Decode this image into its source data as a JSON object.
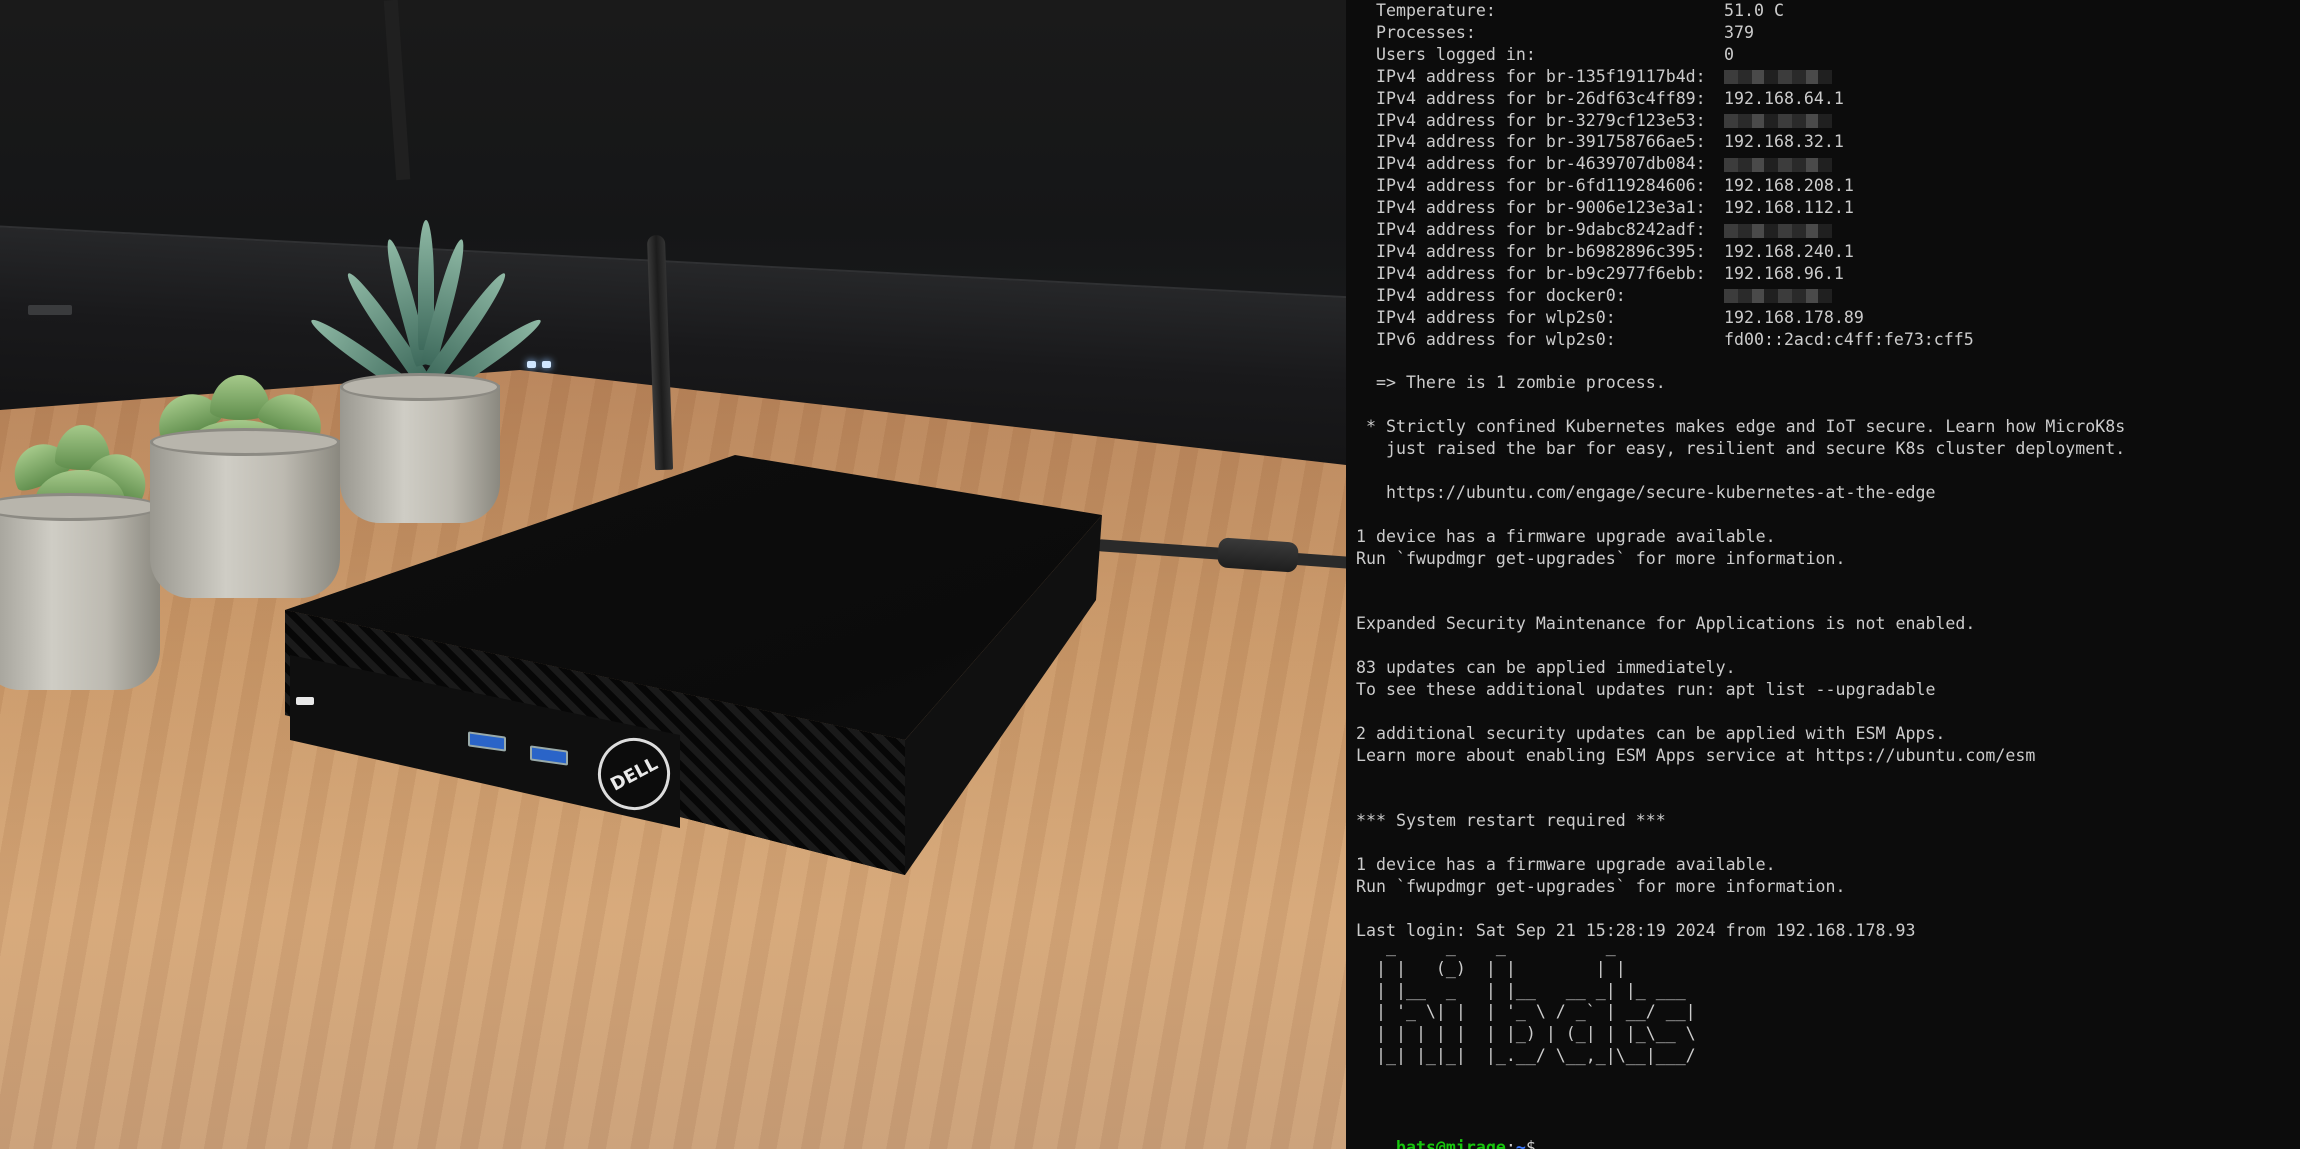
{
  "photo": {
    "brand_logo": "DELL",
    "subject": "mini-pc"
  },
  "terminal": {
    "sysinfo": [
      {
        "label": "  Temperature:",
        "value": "51.0 C",
        "redacted": false
      },
      {
        "label": "  Processes:",
        "value": "379",
        "redacted": false
      },
      {
        "label": "  Users logged in:",
        "value": "0",
        "redacted": false
      },
      {
        "label": "  IPv4 address for br-135f19117b4d:",
        "value": "",
        "redacted": true
      },
      {
        "label": "  IPv4 address for br-26df63c4ff89:",
        "value": "192.168.64.1",
        "redacted": false
      },
      {
        "label": "  IPv4 address for br-3279cf123e53:",
        "value": "",
        "redacted": true
      },
      {
        "label": "  IPv4 address for br-391758766ae5:",
        "value": "192.168.32.1",
        "redacted": false
      },
      {
        "label": "  IPv4 address for br-4639707db084:",
        "value": "",
        "redacted": true
      },
      {
        "label": "  IPv4 address for br-6fd119284606:",
        "value": "192.168.208.1",
        "redacted": false
      },
      {
        "label": "  IPv4 address for br-9006e123e3a1:",
        "value": "192.168.112.1",
        "redacted": false
      },
      {
        "label": "  IPv4 address for br-9dabc8242adf:",
        "value": "",
        "redacted": true
      },
      {
        "label": "  IPv4 address for br-b6982896c395:",
        "value": "192.168.240.1",
        "redacted": false
      },
      {
        "label": "  IPv4 address for br-b9c2977f6ebb:",
        "value": "192.168.96.1",
        "redacted": false
      },
      {
        "label": "  IPv4 address for docker0:",
        "value": "",
        "redacted": true
      },
      {
        "label": "  IPv4 address for wlp2s0:",
        "value": "192.168.178.89",
        "redacted": false
      },
      {
        "label": "  IPv6 address for wlp2s0:",
        "value": "fd00::2acd:c4ff:fe73:cff5",
        "redacted": false
      }
    ],
    "motd": [
      "",
      "  => There is 1 zombie process.",
      "",
      " * Strictly confined Kubernetes makes edge and IoT secure. Learn how MicroK8s",
      "   just raised the bar for easy, resilient and secure K8s cluster deployment.",
      "",
      "   https://ubuntu.com/engage/secure-kubernetes-at-the-edge",
      "",
      "1 device has a firmware upgrade available.",
      "Run `fwupdmgr get-upgrades` for more information.",
      "",
      "",
      "Expanded Security Maintenance for Applications is not enabled.",
      "",
      "83 updates can be applied immediately.",
      "To see these additional updates run: apt list --upgradable",
      "",
      "2 additional security updates can be applied with ESM Apps.",
      "Learn more about enabling ESM Apps service at https://ubuntu.com/esm",
      "",
      "",
      "*** System restart required ***",
      "",
      "1 device has a firmware upgrade available.",
      "Run `fwupdmgr get-upgrades` for more information.",
      "",
      "Last login: Sat Sep 21 15:28:19 2024 from 192.168.178.93"
    ],
    "banner": [
      "   _     _    _          _",
      "  | |   (_)  | |        | |",
      "  | |__  _   | |__   __ _| |_ ___",
      "  | '_ \\| |  | '_ \\ / _` | __/ __|",
      "  | | | | |  | |_) | (_| | |_\\__ \\",
      "  |_| |_|_|  |_.__/ \\__,_|\\__|___/"
    ],
    "prompt": {
      "user_host": "bats@mirage",
      "separator": ":",
      "path": "~",
      "symbol": "$"
    },
    "colors": {
      "background": "#0c0c0c",
      "text": "#cccccc",
      "prompt_user": "#16c60c",
      "prompt_path": "#3b78ff"
    }
  }
}
